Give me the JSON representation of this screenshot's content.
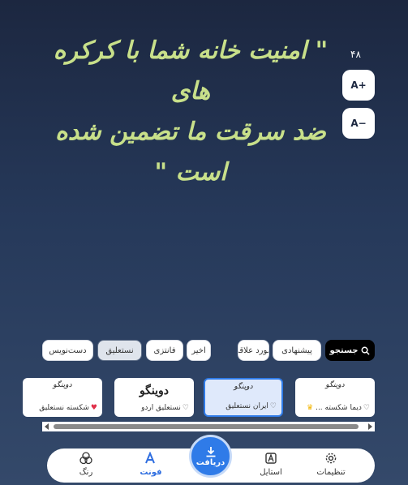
{
  "quote": {
    "text": "\" امنیت خانه شما با کرکره های\nضد سرقت ما تضمین شده است \""
  },
  "size": {
    "value": "۴۸",
    "increase_label": "A+",
    "decrease_label": "A−"
  },
  "chips": [
    {
      "label": "جستجو"
    },
    {
      "label": "پیشنهادی"
    },
    {
      "label": "مورد علاقه"
    },
    {
      "label": "اخیر"
    },
    {
      "label": "فانتزی"
    },
    {
      "label": "نستعلیق"
    },
    {
      "label": "دست‌نویس"
    }
  ],
  "fonts": [
    {
      "preview": "دوینگو",
      "name": "دیما شکسته ..."
    },
    {
      "preview": "دوینگو",
      "name": "ایران نستعلیق"
    },
    {
      "preview": "دوینگو",
      "name": "نستعلیق اردو"
    },
    {
      "preview": "دوینگو",
      "name": "شکسته نستعلیق"
    }
  ],
  "nav": {
    "settings": "تنظیمات",
    "style": "استایل",
    "download": "دریافت",
    "font": "فونت",
    "color": "رنگ"
  },
  "colors": {
    "accent": "#2f7be8",
    "quote": "#c8e08a",
    "heart": "#e0304a",
    "crown": "#f2b400"
  }
}
